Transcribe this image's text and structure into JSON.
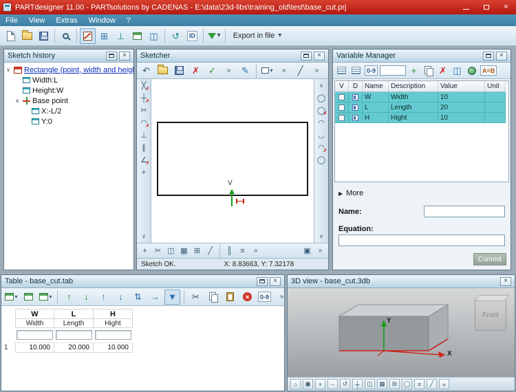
{
  "window": {
    "title": "PARTdesigner 11.00 - PARTsolutions by CADENAS - E:\\data\\23d-libs\\training_old\\test\\base_cut.prj"
  },
  "menu": {
    "file": "File",
    "view": "View",
    "extras": "Extras",
    "window": "Window",
    "help": "?"
  },
  "main_toolbar": {
    "id_label": "ID",
    "export_label": "Export in file"
  },
  "sketch_history": {
    "title": "Sketch history",
    "root_label": "Rectangle (point, width and height)",
    "width_label": "Width:L",
    "height_label": "Height:W",
    "base_point_label": "Base point",
    "x_label": "X:-L/2",
    "y_label": "Y:0"
  },
  "sketcher": {
    "title": "Sketcher",
    "axis_v_label": "V",
    "status_ok": "Sketch OK.",
    "status_coords": "X: 8.83663, Y: 7.32178"
  },
  "variable_manager": {
    "title": "Variable Manager",
    "columns": {
      "v": "V",
      "d": "D",
      "name": "Name",
      "description": "Description",
      "value": "Value",
      "unit": "Unit"
    },
    "rows": [
      {
        "name": "W",
        "description": "Width",
        "value": "10"
      },
      {
        "name": "L",
        "description": "Length",
        "value": "20"
      },
      {
        "name": "H",
        "description": "Hight",
        "value": "10"
      }
    ],
    "more_label": "More",
    "name_label": "Name:",
    "equation_label": "Equation:",
    "commit_label": "Commit",
    "ab_label": "A=B",
    "digits_label": "0-9"
  },
  "table_panel": {
    "title": "Table - base_cut.tab",
    "row_number": "1",
    "digits_label": "0-9",
    "cols": [
      {
        "name": "W",
        "description": "Width",
        "value": "10.000"
      },
      {
        "name": "L",
        "description": "Length",
        "value": "20.000"
      },
      {
        "name": "H",
        "description": "Hight",
        "value": "10.000"
      }
    ]
  },
  "view3d": {
    "title": "3D view - base_cut.3db",
    "axis_x": "X",
    "axis_y": "Y",
    "cube_front_label": "Front"
  },
  "icons": {
    "close": "×",
    "undo": "↶",
    "check": "✓",
    "x": "✗",
    "cut": "✂",
    "overflow": "»",
    "caret": "▾",
    "chev_down": "∨",
    "chev_up": "∧",
    "expander": "∨",
    "more_arrow": "▶",
    "circle": "◯",
    "arc_top": "◠",
    "arc_bottom": "◡",
    "line": "╱",
    "grid": "▦",
    "grid_plus": "⊞",
    "perp": "⊥",
    "parallel": "∥",
    "angle": "∠",
    "cross": "┼",
    "diag_cross": "╳",
    "arrow_right": "→",
    "arrow_up": "↑",
    "arrow_down": "↓",
    "arrow_big_down": "▼",
    "updown": "⇅",
    "rotate": "↺",
    "home": "⌂",
    "plus": "+",
    "minus": "−",
    "equals": "≡",
    "bars": "║",
    "box_split": "◫",
    "pencil": "✎",
    "square": "▣"
  }
}
